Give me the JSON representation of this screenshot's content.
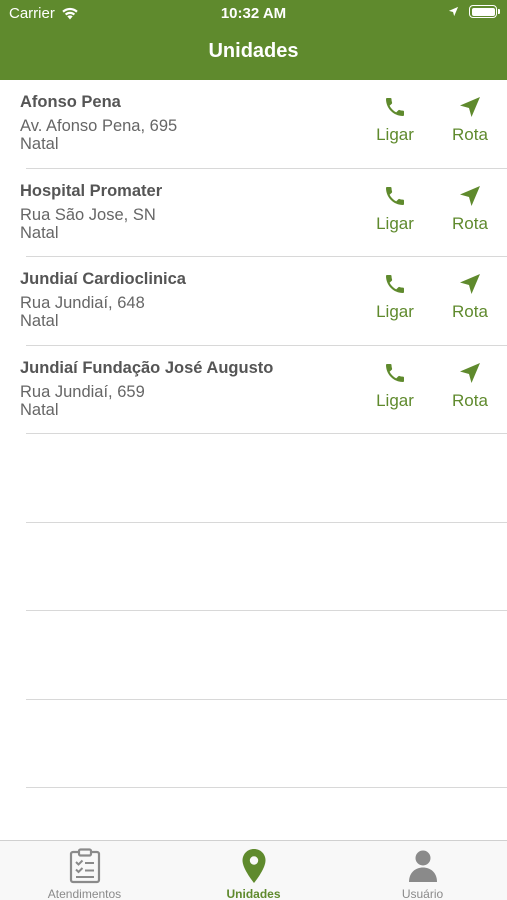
{
  "status_bar": {
    "carrier": "Carrier",
    "time": "10:32 AM"
  },
  "header": {
    "title": "Unidades"
  },
  "units": [
    {
      "name": "Afonso Pena",
      "address": "Av. Afonso Pena, 695",
      "city": "Natal"
    },
    {
      "name": "Hospital Promater",
      "address": "Rua São Jose, SN",
      "city": "Natal"
    },
    {
      "name": "Jundiaí Cardioclinica",
      "address": "Rua Jundiaí, 648",
      "city": "Natal"
    },
    {
      "name": "Jundiaí Fundação José Augusto",
      "address": "Rua Jundiaí, 659",
      "city": "Natal"
    }
  ],
  "actions": {
    "call_label": "Ligar",
    "route_label": "Rota"
  },
  "tabs": [
    {
      "label": "Atendimentos",
      "icon": "clipboard-icon"
    },
    {
      "label": "Unidades",
      "icon": "map-pin-icon"
    },
    {
      "label": "Usuário",
      "icon": "user-icon"
    }
  ],
  "colors": {
    "primary": "#5f8a2d",
    "inactive": "#8a8a8a"
  }
}
